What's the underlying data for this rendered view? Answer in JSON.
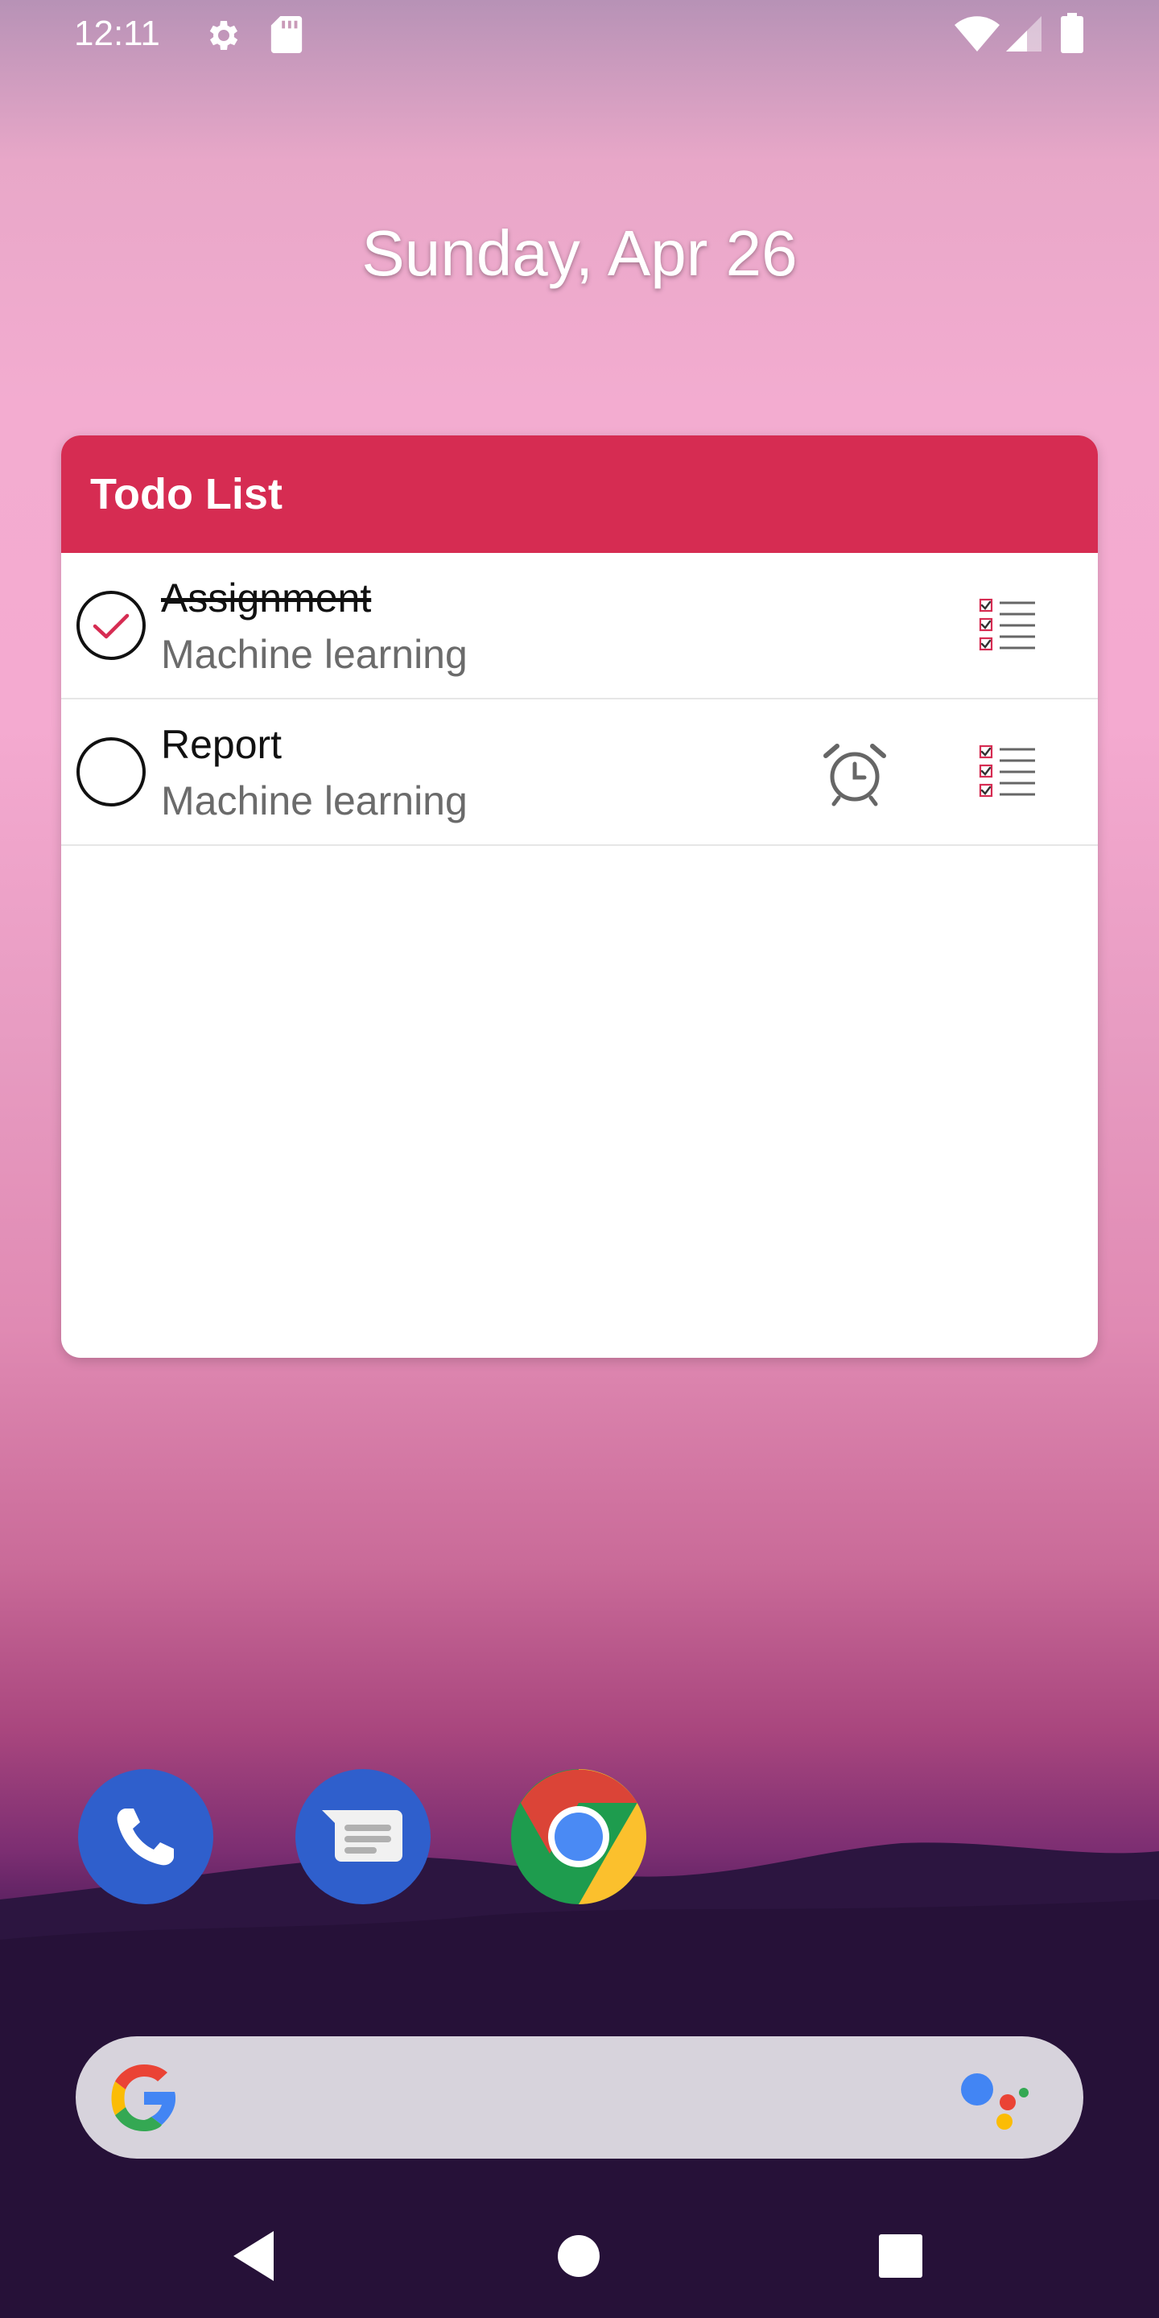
{
  "status_bar": {
    "time": "12:11",
    "icons": [
      "settings-icon",
      "sd-card-icon",
      "wifi-icon",
      "signal-icon",
      "battery-icon"
    ]
  },
  "date": "Sunday, Apr 26",
  "widget": {
    "title": "Todo List",
    "header_color": "#d62c52",
    "items": [
      {
        "title": "Assignment",
        "subtitle": "Machine learning",
        "completed": true,
        "has_alarm": false
      },
      {
        "title": "Report",
        "subtitle": "Machine learning",
        "completed": false,
        "has_alarm": true
      }
    ]
  },
  "dock": {
    "apps": [
      "phone-app-icon",
      "messages-app-icon",
      "chrome-app-icon"
    ]
  },
  "search": {
    "icons": [
      "google-g-icon",
      "assistant-icon"
    ]
  },
  "nav": {
    "buttons": [
      "back-button",
      "home-button",
      "recents-button"
    ]
  }
}
